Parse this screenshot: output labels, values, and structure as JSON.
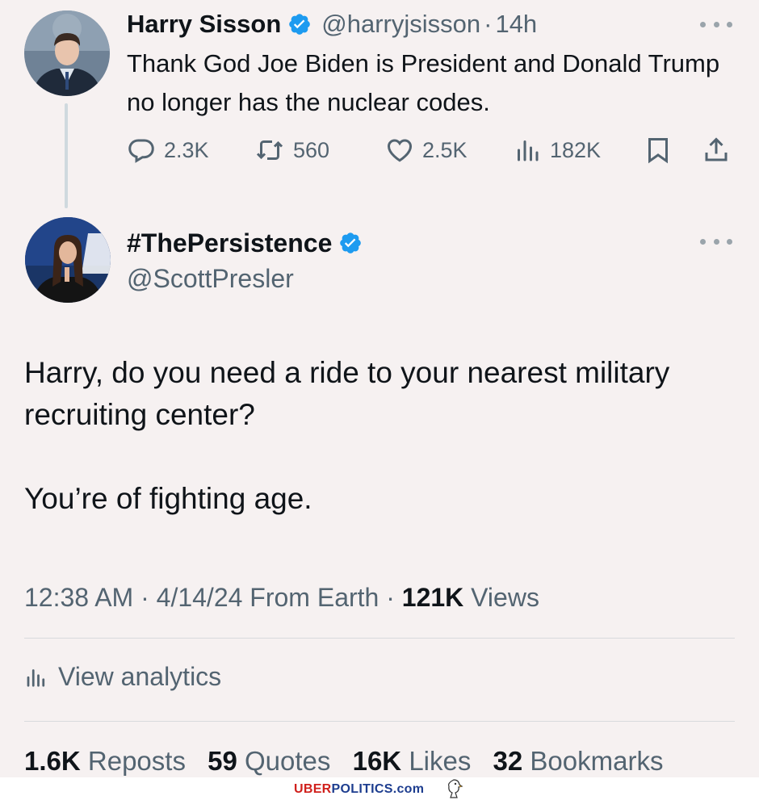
{
  "parent_tweet": {
    "author_name": "Harry Sisson",
    "handle": "@harryjsisson",
    "separator": "·",
    "time": "14h",
    "text": "Thank God Joe Biden is President and Donald Trump no longer has the nuclear codes.",
    "replies": "2.3K",
    "reposts": "560",
    "likes": "2.5K",
    "views": "182K",
    "icons": [
      "more-icon",
      "reply-icon",
      "repost-icon",
      "like-icon",
      "views-icon",
      "bookmark-icon",
      "share-icon"
    ]
  },
  "main_tweet": {
    "author_name": "#ThePersistence",
    "handle": "@ScottPresler",
    "text_line1": "Harry, do you need a ride to your nearest military recruiting center?",
    "text_line2": "You’re of fighting age.",
    "timestamp": "12:38 AM · 4/14/24 From Earth · ",
    "views_count": "121K",
    "views_label": " Views",
    "analytics_label": "View analytics",
    "stats": {
      "reposts_count": "1.6K",
      "reposts_label": "Reposts",
      "quotes_count": "59",
      "quotes_label": "Quotes",
      "likes_count": "16K",
      "likes_label": "Likes",
      "bookmarks_count": "32",
      "bookmarks_label": "Bookmarks"
    }
  },
  "watermark": {
    "part1": "UBER",
    "part2": "POLITICS",
    "part3": ".com"
  },
  "colors": {
    "background": "#f6f1f1",
    "text_primary": "#0f1419",
    "text_secondary": "#536471",
    "verified": "#1d9bf0",
    "watermark_red": "#d0201c",
    "watermark_blue": "#1d3d8f"
  }
}
